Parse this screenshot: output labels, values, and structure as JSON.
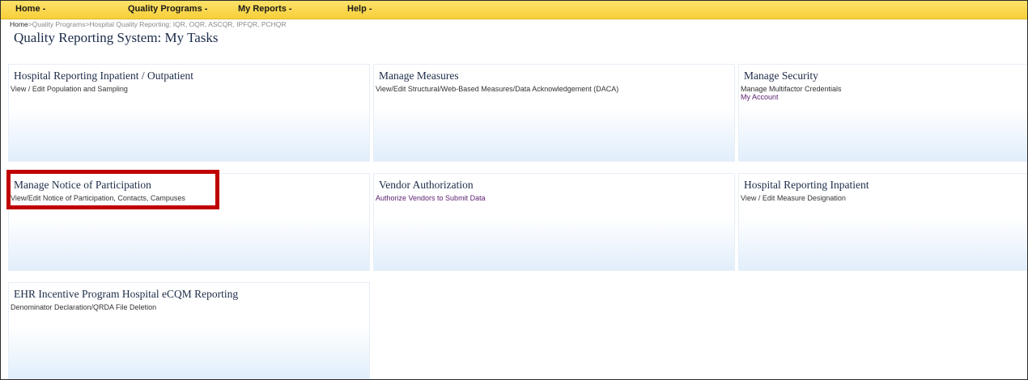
{
  "menu": {
    "items": [
      {
        "label": "Home",
        "caret": "-"
      },
      {
        "label": "Quality Programs",
        "caret": "-"
      },
      {
        "label": "My Reports",
        "caret": "-"
      },
      {
        "label": "Help",
        "caret": "-"
      }
    ]
  },
  "breadcrumb": {
    "home": "Home",
    "sep": ">",
    "quality_programs": "Quality Programs",
    "current": "Hospital Quality Reporting: IQR, OQR, ASCQR, IPFQR, PCHQR"
  },
  "page": {
    "title": "Quality Reporting System: My Tasks"
  },
  "tiles": [
    {
      "title": "Hospital Reporting Inpatient / Outpatient",
      "desc": "View / Edit Population and Sampling"
    },
    {
      "title": "Manage Measures",
      "desc": "View/Edit Structural/Web-Based Measures/Data Acknowledgement (DACA)"
    },
    {
      "title": "Manage Security",
      "desc": "Manage Multifactor Credentials",
      "link": "My Account"
    },
    {
      "title": "Manage Notice of Participation",
      "desc": "View/Edit Notice of Participation, Contacts, Campuses"
    },
    {
      "title": "Vendor Authorization",
      "link": "Authorize Vendors to Submit Data"
    },
    {
      "title": "Hospital Reporting Inpatient",
      "desc": "View / Edit Measure Designation"
    },
    {
      "title": "EHR Incentive Program Hospital eCQM Reporting",
      "desc": "Denominator Declaration/QRDA File Deletion"
    }
  ],
  "colors": {
    "menubar": "#f7cf3a",
    "highlight": "#c00000",
    "link": "#5a1e6e",
    "title": "#1b2c4a"
  }
}
